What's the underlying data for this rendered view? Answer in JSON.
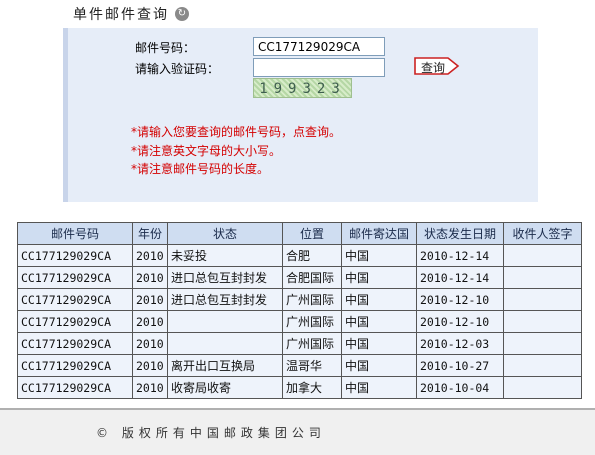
{
  "header": {
    "title": "单件邮件查询"
  },
  "form": {
    "mail_no_label": "邮件号码：",
    "mail_no_value": "CC177129029CA",
    "captcha_label": "请输入验证码：",
    "captcha_value": "",
    "captcha_text": "199323",
    "query_button": "查询"
  },
  "hints": [
    "*请输入您要查询的邮件号码，点查询。",
    "*请注意英文字母的大小写。",
    "*请注意邮件号码的长度。"
  ],
  "table": {
    "headers": [
      "邮件号码",
      "年份",
      "状态",
      "位置",
      "邮件寄达国",
      "状态发生日期",
      "收件人签字"
    ],
    "rows": [
      [
        "CC177129029CA",
        "2010",
        "未妥投",
        "合肥",
        "中国",
        "2010-12-14",
        ""
      ],
      [
        "CC177129029CA",
        "2010",
        "进口总包互封封发",
        "合肥国际",
        "中国",
        "2010-12-14",
        ""
      ],
      [
        "CC177129029CA",
        "2010",
        "进口总包互封封发",
        "广州国际",
        "中国",
        "2010-12-10",
        ""
      ],
      [
        "CC177129029CA",
        "2010",
        "",
        "广州国际",
        "中国",
        "2010-12-10",
        ""
      ],
      [
        "CC177129029CA",
        "2010",
        "",
        "广州国际",
        "中国",
        "2010-12-03",
        ""
      ],
      [
        "CC177129029CA",
        "2010",
        "离开出口互换局",
        "温哥华",
        "中国",
        "2010-10-27",
        ""
      ],
      [
        "CC177129029CA",
        "2010",
        "收寄局收寄",
        "加拿大",
        "中国",
        "2010-10-04",
        ""
      ]
    ]
  },
  "footer": {
    "copyright": "© 版权所有中国邮政集团公司"
  },
  "colors": {
    "hint_red": "#d40000",
    "panel_bg": "#e6edf8",
    "header_bg": "#cfddf1"
  },
  "icons": {
    "title_icon": "circular-arrow-icon"
  }
}
